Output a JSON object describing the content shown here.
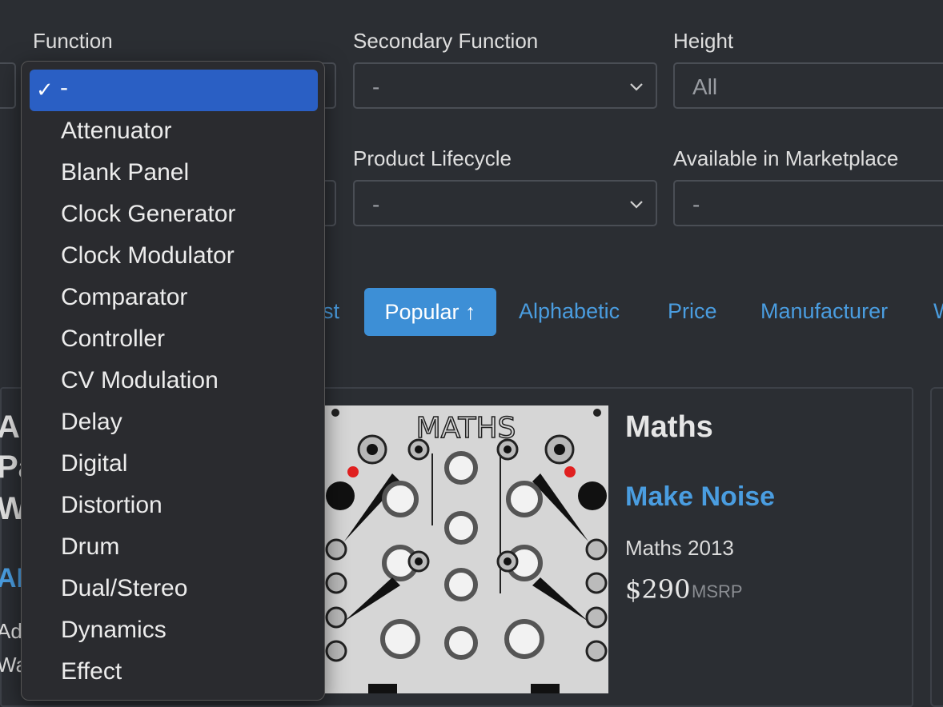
{
  "filters": {
    "function": {
      "label": "Function"
    },
    "secondary_function": {
      "label": "Secondary Function",
      "value": "-"
    },
    "height": {
      "label": "Height",
      "value": "All"
    },
    "product_lifecycle": {
      "label": "Product Lifecycle",
      "value": "-"
    },
    "available_in_marketplace": {
      "label": "Available in Marketplace",
      "value": "-"
    }
  },
  "sort": {
    "partial_left": "st",
    "active": "Popular ↑",
    "options": [
      "Alphabetic",
      "Price",
      "Manufacturer"
    ],
    "partial_right": "W"
  },
  "dropdown": {
    "selected": "-",
    "check": "✓",
    "items": [
      "Attenuator",
      "Blank Panel",
      "Clock Generator",
      "Clock Modulator",
      "Comparator",
      "Controller",
      "CV Modulation",
      "Delay",
      "Digital",
      "Distortion",
      "Drum",
      "Dual/Stereo",
      "Dynamics",
      "Effect"
    ]
  },
  "product": {
    "name": "Maths",
    "manufacturer": "Make Noise",
    "variant": "Maths 2013",
    "price": "$290",
    "price_note": "MSRP",
    "image_title": "MATHS"
  },
  "behind_card": {
    "lines": [
      "Al",
      "Pa",
      "W"
    ],
    "maker": "AL",
    "desc": [
      "Ad",
      "Wa"
    ]
  },
  "colors": {
    "accent": "#3d8fd6",
    "link": "#4a9de0",
    "selected": "#2a5fc4",
    "background": "#2b2e33"
  }
}
